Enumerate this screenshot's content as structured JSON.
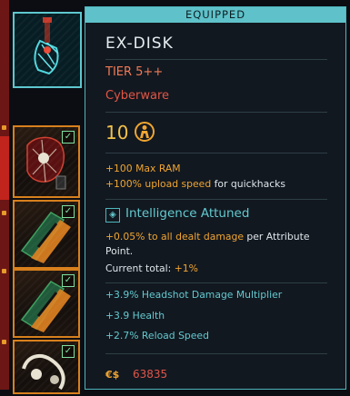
{
  "tooltip": {
    "header": "EQUIPPED",
    "item_name": "EX-DISK",
    "tier": "TIER 5++",
    "item_type": "Cyberware",
    "level": "10",
    "stats": [
      {
        "value": "+100 Max RAM",
        "rest": ""
      },
      {
        "value": "+100% upload speed",
        "rest": " for quickhacks"
      }
    ],
    "attunement": {
      "title": "Intelligence Attuned",
      "bonus_value": "+0.05% to all dealt damage",
      "bonus_rest_1": " per Attribute",
      "bonus_rest_2": "Point.",
      "current_label": "Current total: ",
      "current_value": "+1%"
    },
    "mods": [
      "+3.9% Headshot Damage Multiplier",
      "+3.9 Health",
      "+2.7% Reload Speed"
    ],
    "price_symbol": "€$",
    "price": "63835"
  },
  "colors": {
    "accent_cyan": "#5fc1c9",
    "rarity_orange": "#f0a531",
    "cyberware_red": "#e35544",
    "slot_border": "#d8801d"
  },
  "inventory": {
    "slots": [
      {
        "icon": "cyberdeck-hand-icon",
        "equipped": true
      },
      {
        "icon": "red-implant-icon",
        "equipped": true
      },
      {
        "icon": "green-cyberware-icon",
        "equipped": true
      },
      {
        "icon": "green-cyberware-icon",
        "equipped": true
      },
      {
        "icon": "white-implant-icon",
        "equipped": true
      }
    ],
    "check_mark": "✓"
  }
}
